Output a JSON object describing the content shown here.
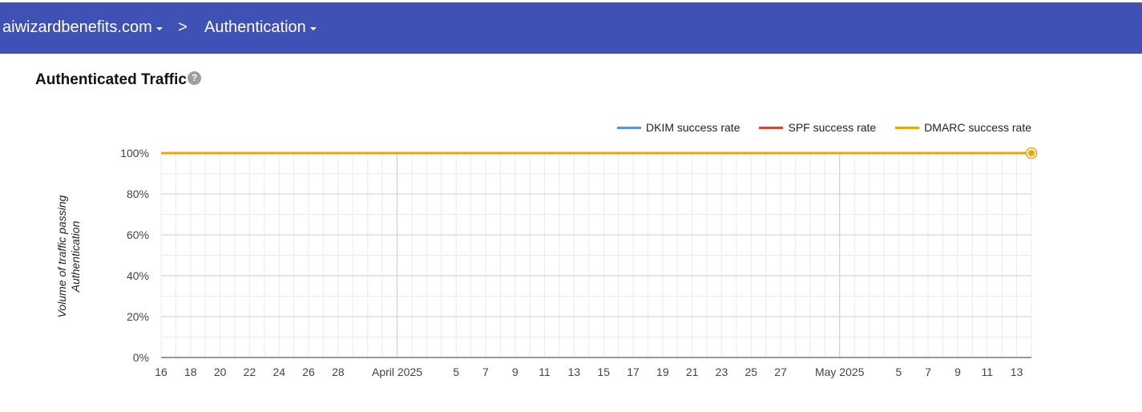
{
  "header": {
    "domain": "aiwizardbenefits.com",
    "separator": ">",
    "page": "Authentication"
  },
  "section": {
    "title": "Authenticated Traffic",
    "help_icon": "question-circle-icon"
  },
  "colors": {
    "header_bg": "#3f51b5",
    "dkim": "#5b8ff0",
    "spf": "#db4437",
    "dmarc": "#f0a30a"
  },
  "chart_data": {
    "type": "line",
    "title": "",
    "xlabel": "",
    "ylabel": "Volume of traffic passing Authentication",
    "ylim": [
      0,
      100
    ],
    "y_ticks": [
      "0%",
      "20%",
      "40%",
      "60%",
      "80%",
      "100%"
    ],
    "x_range": [
      "2025-03-16",
      "2025-05-14"
    ],
    "x_tick_labels": [
      "16",
      "18",
      "20",
      "22",
      "24",
      "26",
      "28",
      "April 2025",
      "5",
      "7",
      "9",
      "11",
      "13",
      "15",
      "17",
      "19",
      "21",
      "23",
      "25",
      "27",
      "May 2025",
      "5",
      "7",
      "9",
      "11",
      "13"
    ],
    "legend_position": "top-right",
    "grid": true,
    "series": [
      {
        "name": "DKIM success rate",
        "color": "#5b8ff0",
        "x": [
          "2025-03-16",
          "2025-05-14"
        ],
        "values": [
          100,
          100
        ]
      },
      {
        "name": "SPF success rate",
        "color": "#db4437",
        "x": [
          "2025-03-16",
          "2025-05-14"
        ],
        "values": [
          100,
          100
        ]
      },
      {
        "name": "DMARC success rate",
        "color": "#f0a30a",
        "x": [
          "2025-03-16",
          "2025-05-14"
        ],
        "values": [
          100,
          100
        ]
      }
    ]
  }
}
